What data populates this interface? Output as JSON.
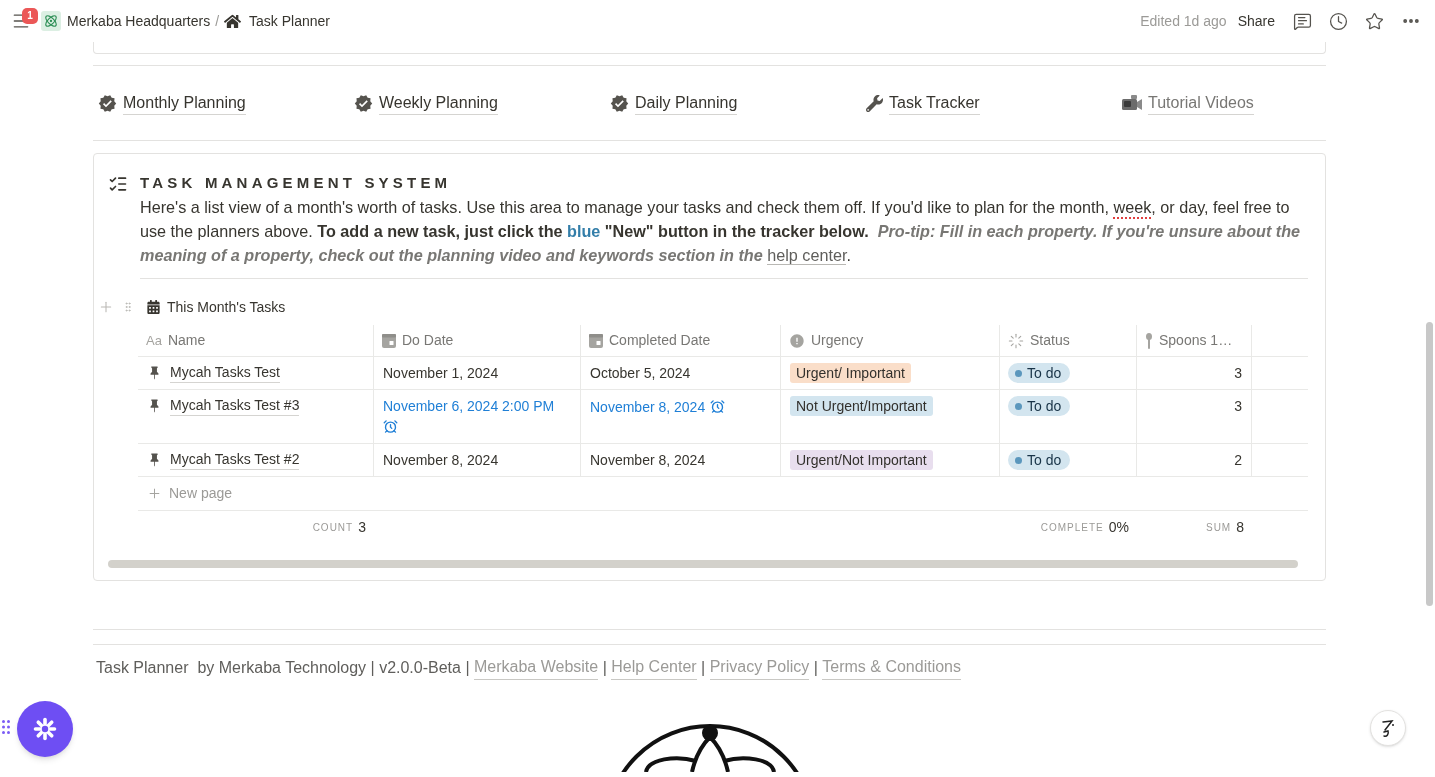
{
  "topbar": {
    "notification_count": "1",
    "breadcrumbs": [
      {
        "label": "Merkaba Headquarters",
        "kind": "workspace"
      },
      {
        "label": "Task Planner",
        "kind": "home"
      }
    ],
    "separator": "/",
    "edited": "Edited 1d ago",
    "share": "Share"
  },
  "nav_links": [
    {
      "label": "Monthly Planning",
      "kind": "verified"
    },
    {
      "label": "Weekly Planning",
      "kind": "verified"
    },
    {
      "label": "Daily Planning",
      "kind": "verified"
    },
    {
      "label": "Task Tracker",
      "kind": "tool"
    },
    {
      "label": "Tutorial Videos",
      "kind": "video"
    }
  ],
  "section": {
    "title": "TASK MANAGEMENT SYSTEM",
    "description": [
      {
        "text": "Here's a list view of a month's worth of tasks. Use this area to manage your tasks and check them off. If you'd like to plan for the month, ",
        "kind": "plain"
      },
      {
        "text": "week",
        "kind": "spellcheck"
      },
      {
        "text": ", or day, feel free to use the planners above. ",
        "kind": "plain"
      },
      {
        "text": "To add a new task, just click the ",
        "kind": "bold"
      },
      {
        "text": "blue",
        "kind": "bold_blue"
      },
      {
        "text": " \"New\" button in the tracker below.  ",
        "kind": "bold"
      },
      {
        "text": "Pro-tip: Fill in each property. If you're unsure about the meaning of a property, check out the planning video and keywords section in the ",
        "kind": "bold_italic_gray"
      },
      {
        "text": "help center",
        "kind": "link"
      },
      {
        "text": ".",
        "kind": "plain"
      }
    ]
  },
  "database": {
    "title": "This Month's Tasks",
    "columns": [
      {
        "label": "Name",
        "kind": "title",
        "glyph": "Aa"
      },
      {
        "label": "Do Date",
        "kind": "date"
      },
      {
        "label": "Completed Date",
        "kind": "date"
      },
      {
        "label": "Urgency",
        "kind": "select"
      },
      {
        "label": "Status",
        "kind": "status"
      },
      {
        "label": "Spoons 1…",
        "kind": "number"
      }
    ],
    "rows": [
      {
        "cells": [
          "Mycah Tasks Test",
          {
            "text": "November 1, 2024",
            "reminder": false
          },
          {
            "text": "October 5, 2024",
            "reminder": false
          },
          {
            "label": "Urgent/ Important",
            "color": "#fadec9"
          },
          "To do",
          "3"
        ]
      },
      {
        "cells": [
          "Mycah Tasks Test #3",
          {
            "text": "November 6, 2024 2:00 PM",
            "reminder": true
          },
          {
            "text": "November 8, 2024",
            "reminder": true
          },
          {
            "label": "Not Urgent/Important",
            "color": "#d3e5ef"
          },
          "To do",
          "3"
        ]
      },
      {
        "cells": [
          "Mycah Tasks Test #2",
          {
            "text": "November 8, 2024",
            "reminder": false
          },
          {
            "text": "November 8, 2024",
            "reminder": false
          },
          {
            "label": "Urgent/Not Important",
            "color": "#e8deee"
          },
          "To do",
          "2"
        ]
      }
    ],
    "new_page": "New page",
    "summary": {
      "title": {
        "label": "COUNT",
        "value": "3"
      },
      "status": {
        "label": "COMPLETE",
        "value": "0%"
      },
      "number": {
        "label": "SUM",
        "value": "8"
      }
    }
  },
  "footer": {
    "parts": [
      {
        "text": "Task Planner  by Merkaba Technology | v2.0.0-Beta | ",
        "kind": "text"
      },
      {
        "text": "Merkaba Website",
        "kind": "link"
      },
      {
        "text": " | ",
        "kind": "text"
      },
      {
        "text": "Help Center",
        "kind": "link"
      },
      {
        "text": " | ",
        "kind": "text"
      },
      {
        "text": "Privacy Policy",
        "kind": "link"
      },
      {
        "text": " | ",
        "kind": "text"
      },
      {
        "text": "Terms & Conditions",
        "kind": "link"
      }
    ]
  }
}
